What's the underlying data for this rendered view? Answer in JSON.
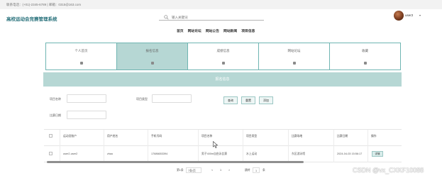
{
  "contact": "联系电话：(+01)-2345-6789 | 邮箱：0315@163.com",
  "site_title": "高校运动会竞赛管理系统",
  "search": {
    "placeholder": "输入关键词"
  },
  "user": {
    "name": "user2"
  },
  "nav": [
    "首页",
    "网站论坛",
    "网站公告",
    "网站新闻",
    "项目信息"
  ],
  "cards": [
    {
      "label": "个人首页"
    },
    {
      "label": "报名信息"
    },
    {
      "label": "成绩信息"
    },
    {
      "label": "网站论坛"
    },
    {
      "label": "收藏"
    }
  ],
  "section_title": "报名信息",
  "filters": {
    "project_name_label": "项目名称",
    "project_type_label": "项目类型",
    "match_date_label": "比赛日期",
    "query_button": "查询",
    "reset_button": "重置",
    "add_button": "添加"
  },
  "table": {
    "columns": [
      "运动员账户",
      "用户姓名",
      "手机号码",
      "项目名称",
      "项目类型",
      "比赛场地",
      "比赛日期",
      "操作"
    ],
    "rows": [
      {
        "account": "user2-user2",
        "name": "zhao",
        "phone": "17686653394",
        "project": "男子400m自由泳比赛",
        "type": "水上运动",
        "venue": "东区游泳馆",
        "date": "2024-04-03 15:56:17",
        "action": "详情"
      }
    ]
  },
  "pager": {
    "first": "第1条",
    "per_page": "7条/页",
    "prev": "<",
    "page": "1",
    "next": ">",
    "goto": "跳转",
    "goto_page": "1",
    "total": "条"
  },
  "watermark": "CSDN @vx_CXKF10088",
  "colors": {
    "accent": "#b6d7d4",
    "title": "#26707a",
    "border": "#6fb5b2"
  }
}
